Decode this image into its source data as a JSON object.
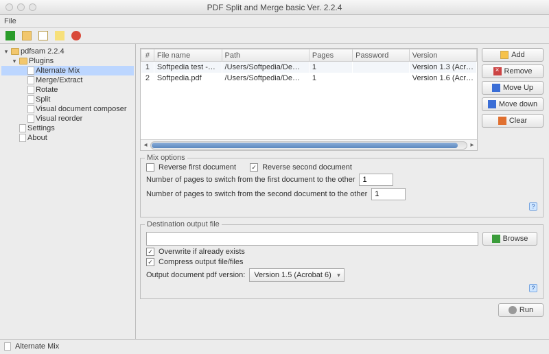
{
  "window": {
    "title": "PDF Split and Merge basic Ver. 2.2.4"
  },
  "menubar": {
    "file": "File"
  },
  "tree": {
    "root": "pdfsam 2.2.4",
    "plugins": "Plugins",
    "items": [
      "Alternate Mix",
      "Merge/Extract",
      "Rotate",
      "Split",
      "Visual document composer",
      "Visual reorder"
    ],
    "settings": "Settings",
    "about": "About",
    "selected": 0
  },
  "table": {
    "headers": [
      "#",
      "File name",
      "Path",
      "Pages",
      "Password",
      "Version"
    ],
    "rows": [
      {
        "n": "1",
        "file": "Softpedia test -…",
        "path": "/Users/Softpedia/De…",
        "pages": "1",
        "pwd": "",
        "ver": "Version 1.3 (Acr…"
      },
      {
        "n": "2",
        "file": "Softpedia.pdf",
        "path": "/Users/Softpedia/De…",
        "pages": "1",
        "pwd": "",
        "ver": "Version 1.6 (Acr…"
      }
    ]
  },
  "buttons": {
    "add": "Add",
    "remove": "Remove",
    "up": "Move Up",
    "down": "Move down",
    "clear": "Clear",
    "browse": "Browse",
    "run": "Run"
  },
  "mix": {
    "legend": "Mix options",
    "rev1_label": "Reverse first document",
    "rev1_checked": false,
    "rev2_label": "Reverse second document",
    "rev2_checked": true,
    "switch1_label": "Number of pages to switch from the first document to the other",
    "switch1_value": "1",
    "switch2_label": "Number of pages to switch from the second document to the other",
    "switch2_value": "1"
  },
  "dest": {
    "legend": "Destination output file",
    "path": "",
    "overwrite_label": "Overwrite if already exists",
    "overwrite_checked": true,
    "compress_label": "Compress output file/files",
    "compress_checked": true,
    "version_label": "Output document pdf version:",
    "version_value": "Version 1.5 (Acrobat 6)"
  },
  "status": {
    "text": "Alternate Mix"
  }
}
